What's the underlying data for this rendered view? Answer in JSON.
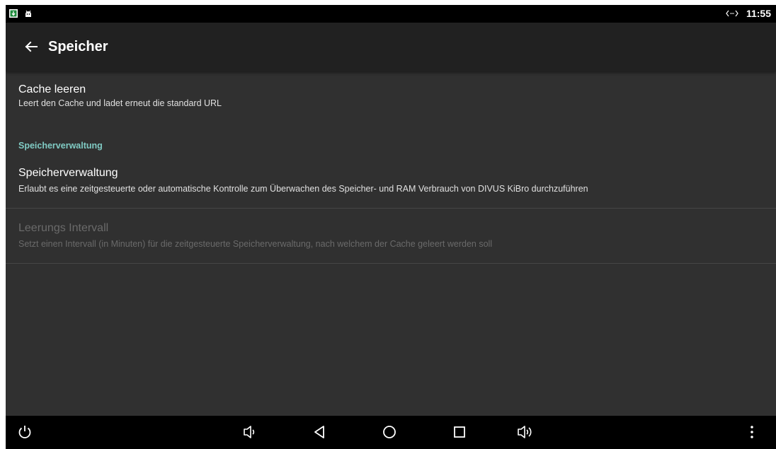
{
  "status_bar": {
    "time": "11:55",
    "icons": [
      "download-notification-icon",
      "android-debug-icon",
      "sync-arrows-icon"
    ]
  },
  "app_bar": {
    "back_icon": "arrow-left-icon",
    "title": "Speicher"
  },
  "preferences": [
    {
      "title": "Cache leeren",
      "summary": "Leert den Cache und ladet erneut die standard URL",
      "enabled": true
    }
  ],
  "category": {
    "title": "Speicherverwaltung",
    "items": [
      {
        "title": "Speicherverwaltung",
        "summary": "Erlaubt es eine zeitgesteuerte oder automatische Kontrolle zum Überwachen des Speicher- und RAM Verbrauch von DIVUS KiBro durchzuführen",
        "enabled": true
      },
      {
        "title": "Leerungs Intervall",
        "summary": "Setzt einen Intervall (in Minuten) für die zeitgesteuerte Speicherverwaltung, nach welchem der Cache geleert werden soll",
        "enabled": false
      }
    ]
  },
  "nav_bar": {
    "icons": [
      "power-icon",
      "volume-down-icon",
      "back-triangle-icon",
      "home-circle-icon",
      "recents-square-icon",
      "volume-up-icon",
      "overflow-menu-icon"
    ]
  },
  "colors": {
    "background": "#303030",
    "app_bar": "#212121",
    "accent": "#80cbc4",
    "disabled_text": "#6a6a6a"
  }
}
